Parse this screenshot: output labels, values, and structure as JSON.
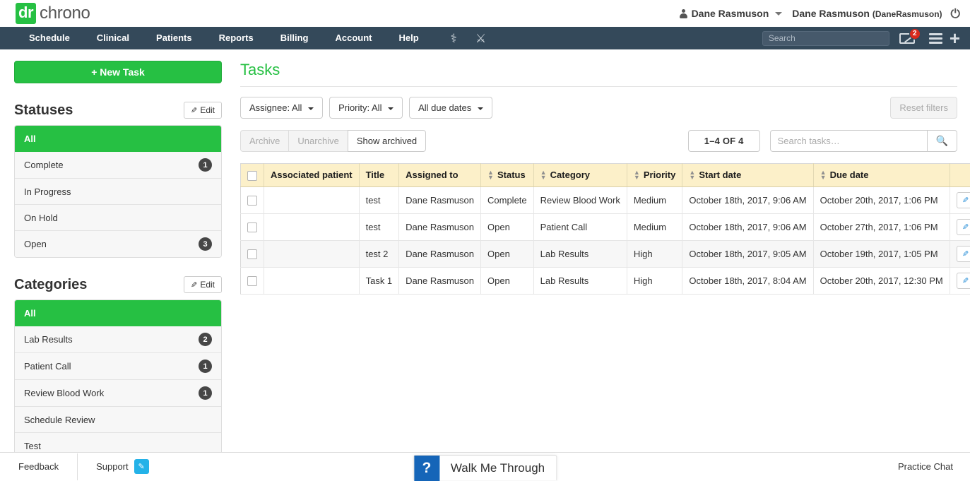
{
  "brand": {
    "logo_dr": "dr",
    "logo_chrono": "chrono",
    "accent_green": "#26c043",
    "nav_dark": "#34495a"
  },
  "topbar": {
    "user_menu_label": "Dane Rasmuson",
    "user_full_name": "Dane Rasmuson",
    "user_handle": "(DaneRasmuson)",
    "power_glyph": "⏻"
  },
  "nav": {
    "items": [
      {
        "label": "Schedule"
      },
      {
        "label": "Clinical"
      },
      {
        "label": "Patients"
      },
      {
        "label": "Reports"
      },
      {
        "label": "Billing"
      },
      {
        "label": "Account"
      },
      {
        "label": "Help"
      }
    ],
    "icons": [
      {
        "name": "caduceus-icon",
        "glyph": "⚕"
      },
      {
        "name": "crossed-tools-icon",
        "glyph": "⚔"
      }
    ],
    "search_placeholder": "Search",
    "search_value": "",
    "mail_badge": "2"
  },
  "sidebar": {
    "new_task_label": "+ New Task",
    "statuses": {
      "title": "Statuses",
      "edit_label": "Edit",
      "items": [
        {
          "label": "All",
          "count": "",
          "active": true
        },
        {
          "label": "Complete",
          "count": "1",
          "active": false
        },
        {
          "label": "In Progress",
          "count": "",
          "active": false
        },
        {
          "label": "On Hold",
          "count": "",
          "active": false
        },
        {
          "label": "Open",
          "count": "3",
          "active": false
        }
      ]
    },
    "categories": {
      "title": "Categories",
      "edit_label": "Edit",
      "items": [
        {
          "label": "All",
          "count": "",
          "active": true
        },
        {
          "label": "Lab Results",
          "count": "2",
          "active": false
        },
        {
          "label": "Patient Call",
          "count": "1",
          "active": false
        },
        {
          "label": "Review Blood Work",
          "count": "1",
          "active": false
        },
        {
          "label": "Schedule Review",
          "count": "",
          "active": false
        },
        {
          "label": "Test",
          "count": "",
          "active": false
        }
      ]
    }
  },
  "main": {
    "page_title": "Tasks",
    "filters": {
      "assignee": "Assignee: All",
      "priority": "Priority: All",
      "due_dates": "All due dates",
      "reset_label": "Reset filters",
      "reset_disabled": true
    },
    "toolbar": {
      "archive_label": "Archive",
      "unarchive_label": "Unarchive",
      "show_archived_label": "Show archived",
      "count_label": "1–4 OF 4",
      "search_placeholder": "Search tasks…",
      "search_value": ""
    },
    "table": {
      "columns": [
        {
          "label": "",
          "sortable": false
        },
        {
          "label": "Associated patient",
          "sortable": false
        },
        {
          "label": "Title",
          "sortable": false
        },
        {
          "label": "Assigned to",
          "sortable": false
        },
        {
          "label": "Status",
          "sortable": true
        },
        {
          "label": "Category",
          "sortable": true
        },
        {
          "label": "Priority",
          "sortable": true
        },
        {
          "label": "Start date",
          "sortable": true
        },
        {
          "label": "Due date",
          "sortable": true
        },
        {
          "label": "",
          "sortable": false
        }
      ],
      "rows": [
        {
          "associated_patient": "",
          "title": "test",
          "assigned_to": "Dane Rasmuson",
          "status": "Complete",
          "category": "Review Blood Work",
          "priority": "Medium",
          "start_date": "October 18th, 2017, 9:06 AM",
          "due_date": "October 20th, 2017, 1:06 PM"
        },
        {
          "associated_patient": "",
          "title": "test",
          "assigned_to": "Dane Rasmuson",
          "status": "Open",
          "category": "Patient Call",
          "priority": "Medium",
          "start_date": "October 18th, 2017, 9:06 AM",
          "due_date": "October 27th, 2017, 1:06 PM"
        },
        {
          "associated_patient": "",
          "title": "test 2",
          "assigned_to": "Dane Rasmuson",
          "status": "Open",
          "category": "Lab Results",
          "priority": "High",
          "start_date": "October 18th, 2017, 9:05 AM",
          "due_date": "October 19th, 2017, 1:05 PM"
        },
        {
          "associated_patient": "",
          "title": "Task 1",
          "assigned_to": "Dane Rasmuson",
          "status": "Open",
          "category": "Lab Results",
          "priority": "High",
          "start_date": "October 18th, 2017, 8:04 AM",
          "due_date": "October 20th, 2017, 12:30 PM"
        }
      ]
    }
  },
  "footer": {
    "feedback_label": "Feedback",
    "support_label": "Support",
    "walkme_badge": "?",
    "walkme_label": "Walk Me Through",
    "practice_chat_label": "Practice Chat"
  }
}
